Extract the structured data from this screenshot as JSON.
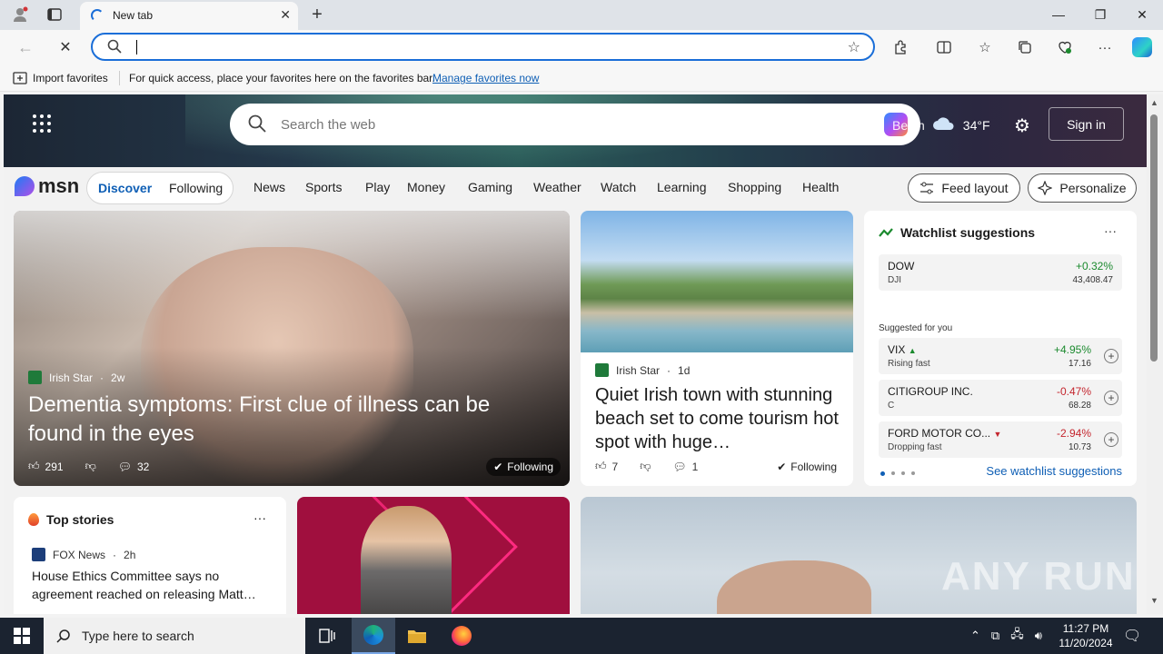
{
  "browser": {
    "tab_title": "New tab",
    "address_value": "",
    "favorites_bar": {
      "import_label": "Import favorites",
      "hint": "For quick access, place your favorites here on the favorites bar.",
      "manage_link": "Manage favorites now"
    }
  },
  "msn": {
    "search_placeholder": "Search the web",
    "weather": {
      "city": "Berlin",
      "temp": "34°F"
    },
    "signin_label": "Sign in",
    "logo_text": "msn",
    "tabs": {
      "discover": "Discover",
      "following": "Following"
    },
    "nav": [
      "News",
      "Sports",
      "Play",
      "Money",
      "Gaming",
      "Weather",
      "Watch",
      "Learning",
      "Shopping",
      "Health"
    ],
    "feed_layout_label": "Feed layout",
    "personalize_label": "Personalize"
  },
  "cards": {
    "dementia": {
      "source": "Irish Star",
      "age": "2w",
      "headline": "Dementia symptoms: First clue of illness can be found in the eyes",
      "likes": "291",
      "comments": "32",
      "follow_label": "Following"
    },
    "irish": {
      "source": "Irish Star",
      "age": "1d",
      "headline": "Quiet Irish town with stunning beach set to come tourism hot spot with huge…",
      "likes": "7",
      "comments": "1",
      "follow_label": "Following"
    },
    "watchlist": {
      "title": "Watchlist suggestions",
      "suggested_label": "Suggested for you",
      "see_more": "See watchlist suggestions",
      "stocks": [
        {
          "symbol": "DOW",
          "sub": "DJI",
          "change": "+0.32%",
          "price": "43,408.47",
          "direction": "up"
        },
        {
          "symbol": "VIX",
          "sub": "Rising fast",
          "change": "+4.95%",
          "price": "17.16",
          "direction": "up"
        },
        {
          "symbol": "CITIGROUP INC.",
          "sub": "C",
          "change": "-0.47%",
          "price": "68.28",
          "direction": "down"
        },
        {
          "symbol": "FORD MOTOR CO...",
          "sub": "Dropping fast",
          "change": "-2.94%",
          "price": "10.73",
          "direction": "down"
        }
      ]
    },
    "top_stories": {
      "title": "Top stories",
      "source": "FOX News",
      "age": "2h",
      "headline": "House Ethics Committee says no agreement reached on releasing Matt…"
    }
  },
  "watermark": "ANY RUN",
  "taskbar": {
    "search_placeholder": "Type here to search",
    "time": "11:27 PM",
    "date": "11/20/2024"
  },
  "colors": {
    "accent": "#0f5fb5",
    "up": "#1b8a2e",
    "down": "#c4262e"
  }
}
